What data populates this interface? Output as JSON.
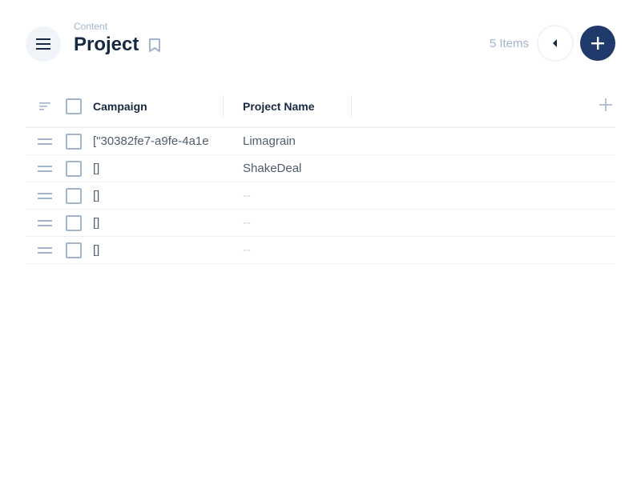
{
  "header": {
    "breadcrumb": "Content",
    "title": "Project",
    "item_count": "5 Items"
  },
  "table": {
    "columns": [
      {
        "label": "Campaign"
      },
      {
        "label": "Project Name"
      }
    ],
    "rows": [
      {
        "campaign": "[\"30382fe7-a9fe-4a1e",
        "project_name": "Limagrain"
      },
      {
        "campaign": "[]",
        "project_name": "ShakeDeal"
      },
      {
        "campaign": "[]",
        "project_name": "--"
      },
      {
        "campaign": "[]",
        "project_name": "--"
      },
      {
        "campaign": "[]",
        "project_name": "--"
      }
    ]
  },
  "colors": {
    "accent": "#1f3a6b",
    "muted": "#a2b5cd",
    "title": "#172940"
  },
  "icons": {
    "menu": "menu-icon",
    "bookmark": "bookmark-icon",
    "collapse": "caret-left-icon",
    "add": "plus-icon",
    "sort": "sort-icon",
    "drag": "drag-handle-icon"
  }
}
